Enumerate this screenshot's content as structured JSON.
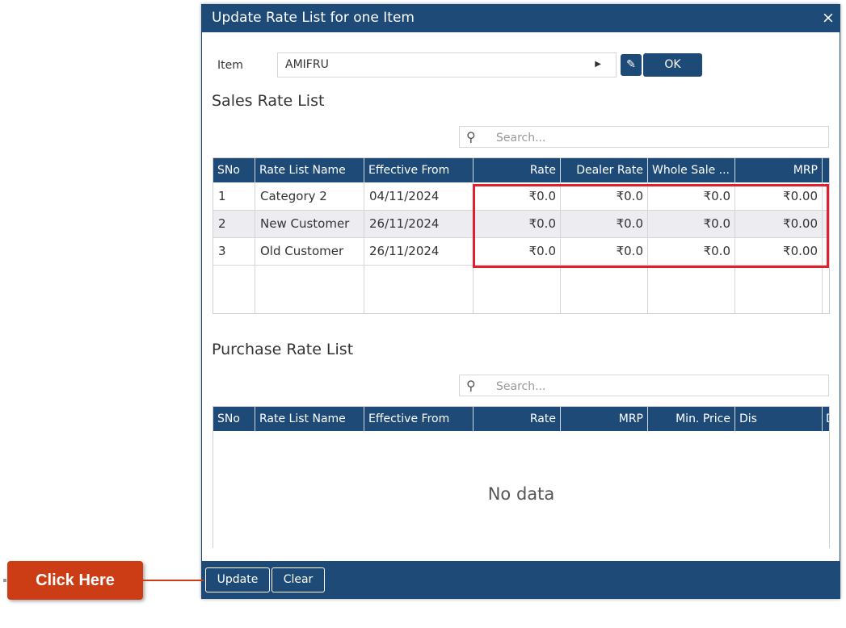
{
  "dialog": {
    "title": "Update Rate List for one Item",
    "close_glyph": "×"
  },
  "item": {
    "label": "Item",
    "value": "AMIFRU",
    "arrow_glyph": "▶",
    "edit_glyph": "✎",
    "ok_label": "OK"
  },
  "sales": {
    "title": "Sales Rate List",
    "search_placeholder": "Search...",
    "columns": [
      "SNo",
      "Rate List Name",
      "Effective From",
      "Rate",
      "Dealer Rate",
      "Whole Sale ...",
      "MRP"
    ],
    "rows": [
      [
        "1",
        "Category 2",
        "04/11/2024",
        "₹0.0",
        "₹0.0",
        "₹0.0",
        "₹0.00"
      ],
      [
        "2",
        "New Customer",
        "26/11/2024",
        "₹0.0",
        "₹0.0",
        "₹0.0",
        "₹0.00"
      ],
      [
        "3",
        "Old Customer",
        "26/11/2024",
        "₹0.0",
        "₹0.0",
        "₹0.0",
        "₹0.00"
      ]
    ]
  },
  "purchase": {
    "title": "Purchase Rate List",
    "search_placeholder": "Search...",
    "columns": [
      "SNo",
      "Rate List Name",
      "Effective From",
      "Rate",
      "MRP",
      "Min. Price",
      "Dis",
      "D"
    ],
    "empty_text": "No data"
  },
  "footer": {
    "update_label": "Update",
    "clear_label": "Clear"
  },
  "callout": {
    "text": "Click Here"
  },
  "colors": {
    "primary": "#1e4a77",
    "highlight": "#e0202f",
    "callout": "#cc3d16"
  }
}
